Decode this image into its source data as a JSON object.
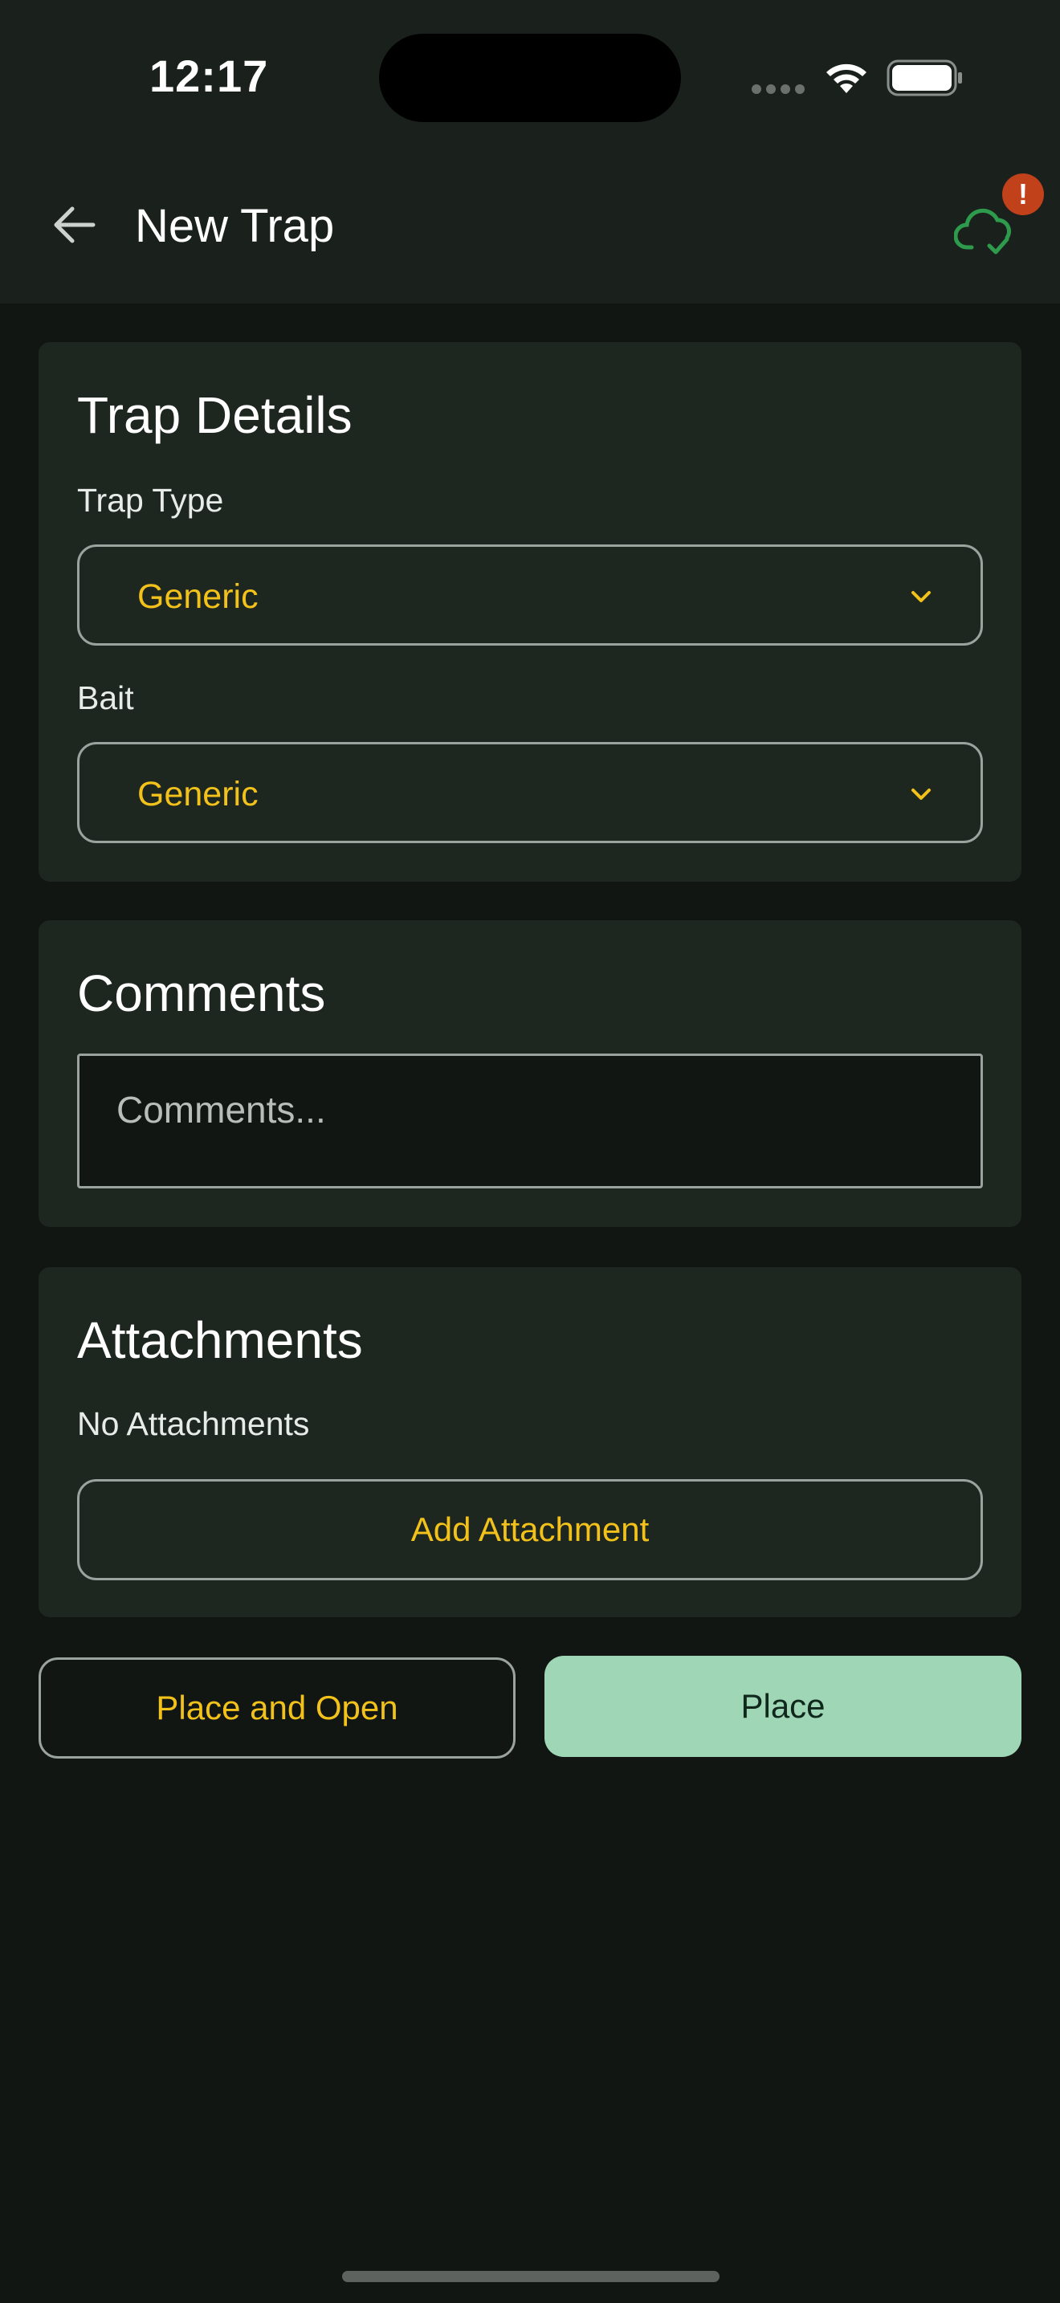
{
  "status_bar": {
    "time": "12:17"
  },
  "header": {
    "title": "New Trap",
    "back_icon": "arrow-left-icon",
    "sync_icon": "cloud-check-icon",
    "badge": "!"
  },
  "trap_details": {
    "title": "Trap Details",
    "trap_type_label": "Trap Type",
    "trap_type_value": "Generic",
    "bait_label": "Bait",
    "bait_value": "Generic"
  },
  "comments": {
    "title": "Comments",
    "placeholder": "Comments..."
  },
  "attachments": {
    "title": "Attachments",
    "empty_text": "No Attachments",
    "add_label": "Add Attachment"
  },
  "actions": {
    "place_and_open_label": "Place and Open",
    "place_label": "Place"
  },
  "colors": {
    "accent_yellow": "#f2c21b",
    "primary_green": "#9fd7b6",
    "sync_green": "#2e9a4c",
    "badge_red": "#c0411a",
    "background": "#111613",
    "card": "#1e2620"
  }
}
